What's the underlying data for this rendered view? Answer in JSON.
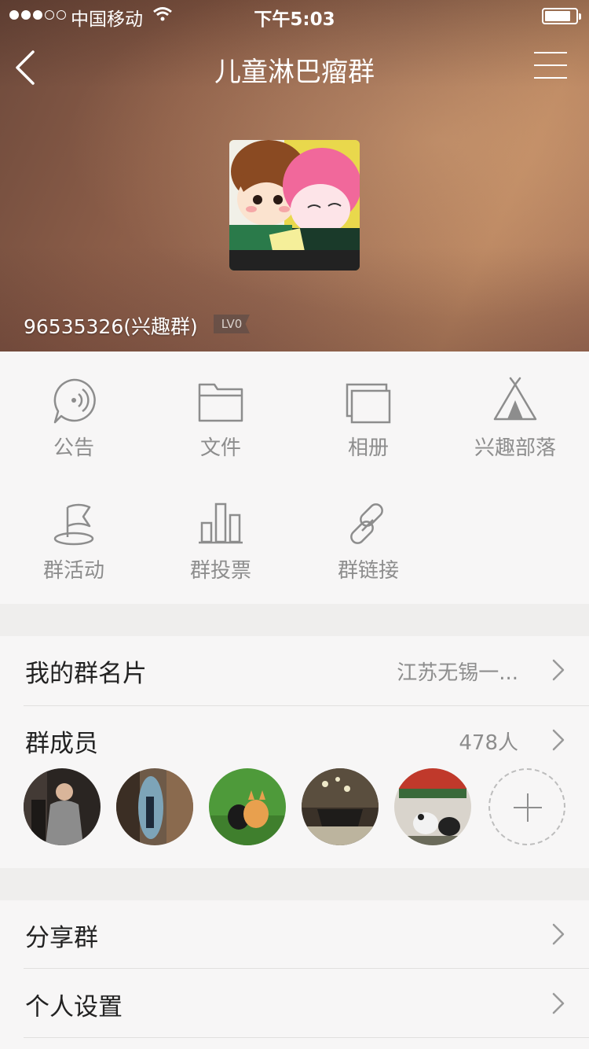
{
  "status_bar": {
    "carrier": "中国移动",
    "time": "下午5:03"
  },
  "nav": {
    "title": "儿童淋巴瘤群"
  },
  "group": {
    "id_text": "96535326(兴趣群)",
    "level": "LV0"
  },
  "features": [
    {
      "label": "公告",
      "icon": "announcement-icon"
    },
    {
      "label": "文件",
      "icon": "folder-icon"
    },
    {
      "label": "相册",
      "icon": "album-icon"
    },
    {
      "label": "兴趣部落",
      "icon": "tent-icon"
    },
    {
      "label": "群活动",
      "icon": "flag-icon"
    },
    {
      "label": "群投票",
      "icon": "bar-chart-icon"
    },
    {
      "label": "群链接",
      "icon": "link-icon"
    }
  ],
  "card": {
    "title": "我的群名片",
    "value": "江苏无锡一..."
  },
  "members": {
    "title": "群成员",
    "count": "478人",
    "avatars": [
      "member-avatar-1",
      "member-avatar-2",
      "member-avatar-3",
      "member-avatar-4",
      "member-avatar-5"
    ]
  },
  "share": {
    "title": "分享群"
  },
  "personal": {
    "title": "个人设置"
  },
  "colors": {
    "header_bg": "#9b6c54",
    "page_bg": "#efeeed",
    "section_bg": "#f7f6f6",
    "icon_gray": "#8d8d8d"
  }
}
